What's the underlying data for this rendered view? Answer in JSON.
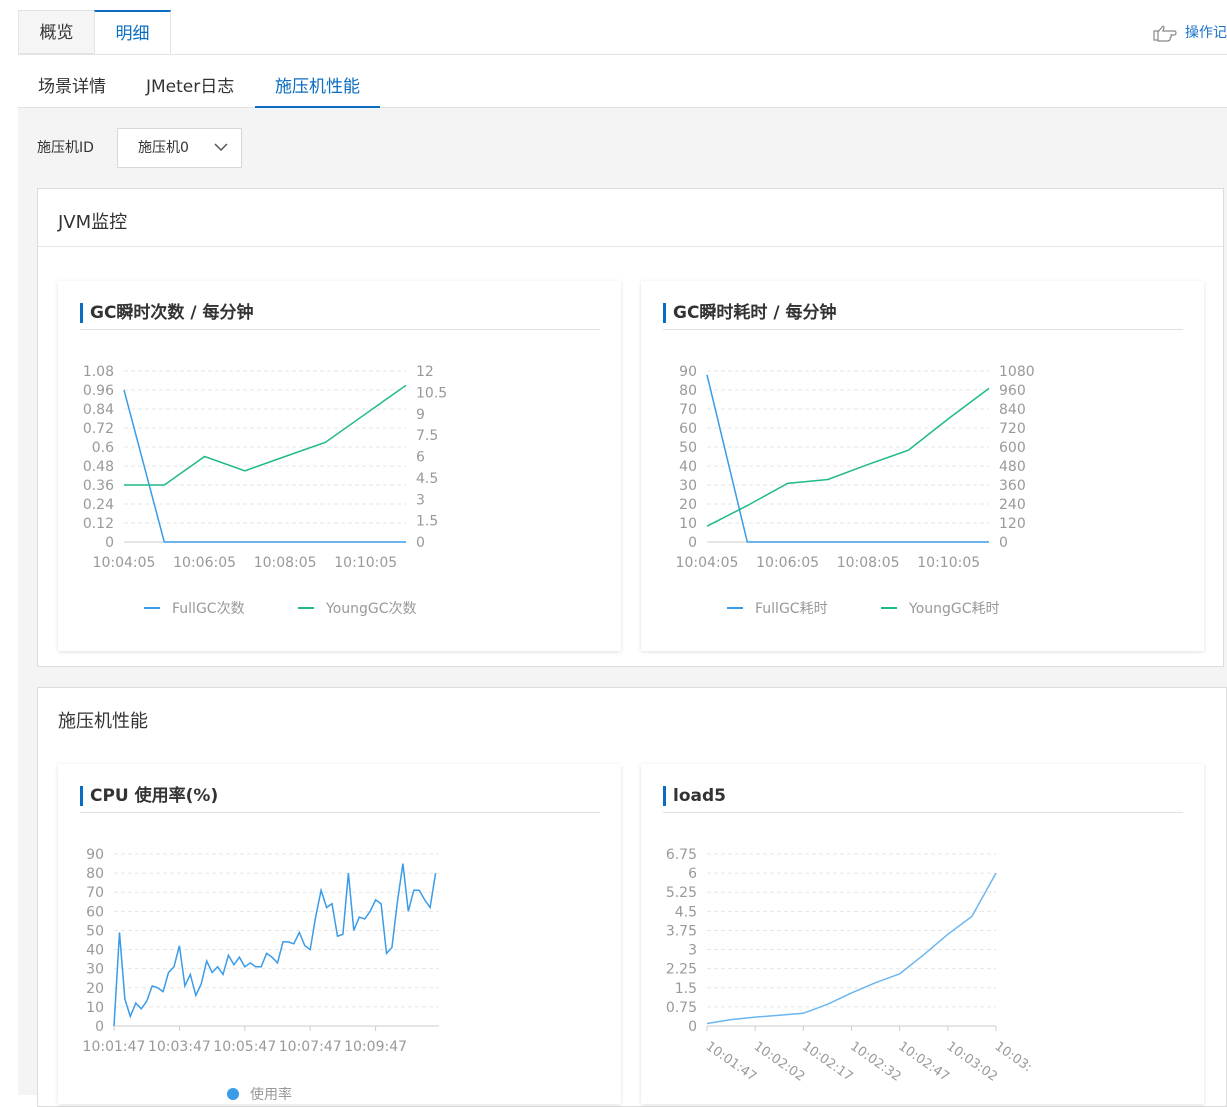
{
  "top_tabs": [
    {
      "label": "概览"
    },
    {
      "label": "明细"
    }
  ],
  "op_log": "操作记",
  "sub_tabs": [
    {
      "label": "场景详情"
    },
    {
      "label": "JMeter日志"
    },
    {
      "label": "施压机性能"
    }
  ],
  "machine_select": {
    "label": "施压机ID",
    "value": "施压机0"
  },
  "jvm_panel": {
    "title": "JVM监控"
  },
  "perf_panel": {
    "title": "施压机性能"
  },
  "colors": {
    "accent": "#0a6dc1",
    "series_blue": "#3a9be8",
    "series_green": "#1fb98a",
    "cpu_line": "#3a9be8",
    "load_line": "#6bb6f0"
  },
  "chart_data": [
    {
      "id": "gc_count",
      "type": "line",
      "title": "GC瞬时次数 / 每分钟",
      "x": [
        "10:04:05",
        "10:05:05",
        "10:06:05",
        "10:07:05",
        "10:08:05",
        "10:09:05",
        "10:10:05",
        "10:11:05"
      ],
      "x_tick_labels": [
        "10:04:05",
        "10:06:05",
        "10:08:05",
        "10:10:05"
      ],
      "y_left": {
        "ticks": [
          "0",
          "0.12",
          "0.24",
          "0.36",
          "0.48",
          "0.6",
          "0.72",
          "0.84",
          "0.96",
          "1.08"
        ],
        "range": [
          0,
          1.08
        ]
      },
      "y_right": {
        "ticks": [
          "0",
          "1.5",
          "3",
          "4.5",
          "6",
          "7.5",
          "9",
          "10.5",
          "12"
        ],
        "range": [
          0,
          12
        ]
      },
      "series": [
        {
          "name": "FullGC次数",
          "axis": "left",
          "values": [
            0.96,
            0,
            0,
            0,
            0,
            0,
            0,
            0
          ]
        },
        {
          "name": "YoungGC次数",
          "axis": "right",
          "values": [
            4,
            4,
            6,
            5,
            6,
            7,
            9,
            11
          ]
        }
      ],
      "legend": "bottom"
    },
    {
      "id": "gc_time",
      "type": "line",
      "title": "GC瞬时耗时 / 每分钟",
      "x": [
        "10:04:05",
        "10:05:05",
        "10:06:05",
        "10:07:05",
        "10:08:05",
        "10:09:05",
        "10:10:05",
        "10:11:05"
      ],
      "x_tick_labels": [
        "10:04:05",
        "10:06:05",
        "10:08:05",
        "10:10:05"
      ],
      "y_left": {
        "ticks": [
          "0",
          "10",
          "20",
          "30",
          "40",
          "50",
          "60",
          "70",
          "80",
          "90"
        ],
        "range": [
          0,
          90
        ]
      },
      "y_right": {
        "ticks": [
          "0",
          "120",
          "240",
          "360",
          "480",
          "600",
          "720",
          "840",
          "960",
          "1080"
        ],
        "range": [
          0,
          1080
        ]
      },
      "series": [
        {
          "name": "FullGC耗时",
          "axis": "left",
          "values": [
            88,
            0,
            0,
            0,
            0,
            0,
            0,
            0
          ]
        },
        {
          "name": "YoungGC耗时",
          "axis": "right",
          "values": [
            100,
            230,
            370,
            395,
            490,
            580,
            780,
            970
          ]
        }
      ],
      "legend": "bottom"
    },
    {
      "id": "cpu",
      "type": "line",
      "title": "CPU 使用率(%)",
      "x_tick_labels": [
        "10:01:47",
        "10:03:47",
        "10:05:47",
        "10:07:47",
        "10:09:47"
      ],
      "x_tick_index": [
        0,
        12,
        24,
        36,
        48
      ],
      "y": {
        "ticks": [
          "0",
          "10",
          "20",
          "30",
          "40",
          "50",
          "60",
          "70",
          "80",
          "90"
        ],
        "range": [
          0,
          90
        ]
      },
      "series": [
        {
          "name": "使用率",
          "values": [
            0,
            49,
            14,
            5,
            12,
            9,
            13,
            21,
            20,
            18,
            28,
            31,
            42,
            21,
            27,
            16,
            22,
            34,
            28,
            31,
            27,
            37,
            32,
            36,
            31,
            33,
            31,
            31,
            38,
            36,
            33,
            44,
            44,
            43,
            49,
            42,
            40,
            57,
            71,
            62,
            64,
            47,
            48,
            80,
            50,
            57,
            56,
            60,
            66,
            64,
            38,
            41,
            65,
            85,
            60,
            71,
            71,
            66,
            62,
            80
          ]
        }
      ],
      "legend": "bottom"
    },
    {
      "id": "load5",
      "type": "line",
      "title": "load5",
      "x_tick_labels": [
        "10:01:47",
        "10:02:02",
        "10:02:17",
        "10:02:32",
        "10:02:47",
        "10:03:02",
        "10:03:"
      ],
      "x": [
        "10:01:47",
        "10:01:54",
        "10:02:02",
        "10:02:09",
        "10:02:17",
        "10:02:24",
        "10:02:32",
        "10:02:39",
        "10:02:47",
        "10:02:54",
        "10:03:02",
        "10:03:09",
        "10:03:17"
      ],
      "y": {
        "ticks": [
          "0",
          "0.75",
          "1.5",
          "2.25",
          "3",
          "3.75",
          "4.5",
          "5.25",
          "6",
          "6.75"
        ],
        "range": [
          0,
          6.75
        ]
      },
      "series": [
        {
          "name": "load5",
          "values": [
            0.1,
            0.25,
            0.35,
            0.42,
            0.5,
            0.85,
            1.3,
            1.7,
            2.05,
            2.8,
            3.6,
            4.3,
            6.0
          ]
        }
      ]
    }
  ]
}
